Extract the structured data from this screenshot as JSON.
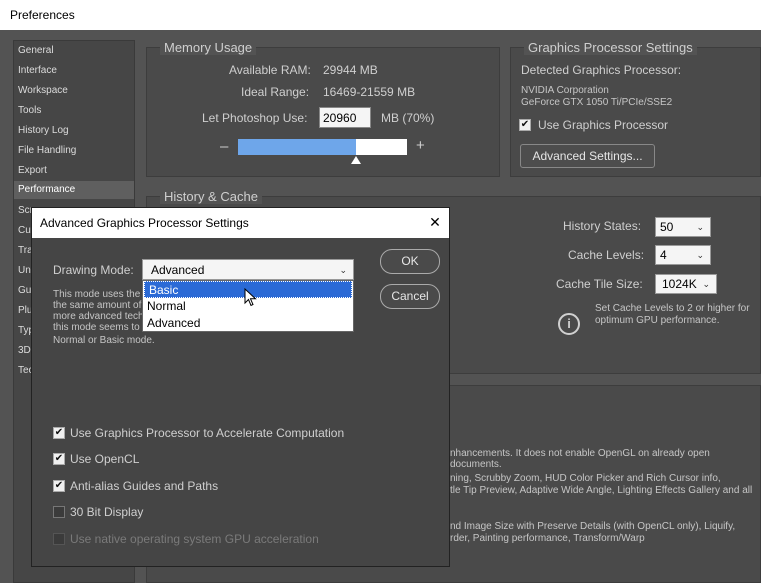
{
  "window": {
    "title": "Preferences"
  },
  "sidebar": {
    "items": [
      {
        "label": "General"
      },
      {
        "label": "Interface"
      },
      {
        "label": "Workspace"
      },
      {
        "label": "Tools"
      },
      {
        "label": "History Log"
      },
      {
        "label": "File Handling"
      },
      {
        "label": "Export"
      },
      {
        "label": "Performance"
      },
      {
        "label": "Scr"
      },
      {
        "label": "Cu"
      },
      {
        "label": "Tra"
      },
      {
        "label": "Un"
      },
      {
        "label": "Gu"
      },
      {
        "label": "Plu"
      },
      {
        "label": "Typ"
      },
      {
        "label": "3D"
      },
      {
        "label": "Tec"
      }
    ]
  },
  "memory": {
    "title": "Memory Usage",
    "available_label": "Available RAM:",
    "available_value": "29944 MB",
    "ideal_label": "Ideal Range:",
    "ideal_value": "16469-21559 MB",
    "let_label": "Let Photoshop Use:",
    "let_value": "20960",
    "let_suffix": "MB (70%)",
    "minus": "–",
    "plus": "+",
    "usage_fraction": 0.7
  },
  "gpu": {
    "title": "Graphics Processor Settings",
    "detected_label": "Detected Graphics Processor:",
    "vendor": "NVIDIA Corporation",
    "model": "GeForce GTX 1050 Ti/PCIe/SSE2",
    "use_gpu_label": "Use Graphics Processor",
    "advanced_button": "Advanced Settings..."
  },
  "history": {
    "title": "History & Cache",
    "states_label": "History States:",
    "states_value": "50",
    "levels_label": "Cache Levels:",
    "levels_value": "4",
    "tile_label": "Cache Tile Size:",
    "tile_value": "1024K",
    "tip_line1": "Set Cache Levels to 2 or higher for",
    "tip_line2": "optimum GPU performance."
  },
  "bg_text": {
    "line1": "nhancements. It does not enable OpenGL on already open documents.",
    "line2": "ning, Scrubby Zoom, HUD Color Picker and Rich Cursor info,",
    "line3": "tle Tip Preview, Adaptive Wide Angle, Lighting Effects Gallery and all",
    "line4": "nd Image Size with Preserve Details (with OpenCL only), Liquify,",
    "line5": "rder, Painting performance, Transform/Warp"
  },
  "dialog": {
    "title": "Advanced Graphics Processor Settings",
    "close": "✕",
    "drawing_mode_label": "Drawing Mode:",
    "drawing_mode_value": "Advanced",
    "desc1": "This mode uses the",
    "desc2": "the same amount of",
    "desc3": "more advanced tech",
    "desc4": "this mode seems to",
    "desc5": "Normal or Basic mode.",
    "ok": "OK",
    "cancel": "Cancel",
    "options": [
      "Basic",
      "Normal",
      "Advanced"
    ],
    "checks": {
      "accelerate": "Use Graphics Processor to Accelerate Computation",
      "opencl": "Use OpenCL",
      "antialias": "Anti-alias Guides and Paths",
      "bit30": "30 Bit Display",
      "native": "Use native operating system GPU acceleration"
    }
  }
}
